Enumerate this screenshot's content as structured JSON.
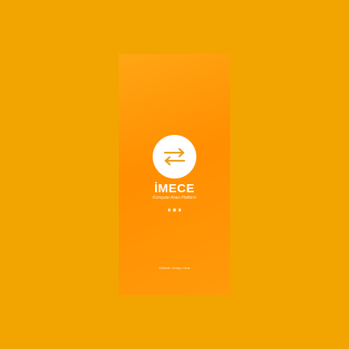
{
  "app": {
    "title": "İMECE",
    "subtitle": "Komşular Arası Platform",
    "footer": "Güvenli • Kolay • Hızlı"
  },
  "logo": {
    "icon": "swap-arrows-icon"
  },
  "loader": {
    "dots": 3
  },
  "colors": {
    "background": "#F2A500",
    "screen_gradient_start": "#FFA614",
    "screen_gradient_mid": "#FF8E00",
    "logo_bg": "#FFFFFF",
    "logo_icon": "#E9A020",
    "text": "#FFFFFF",
    "dots": "#FFE7C2"
  }
}
